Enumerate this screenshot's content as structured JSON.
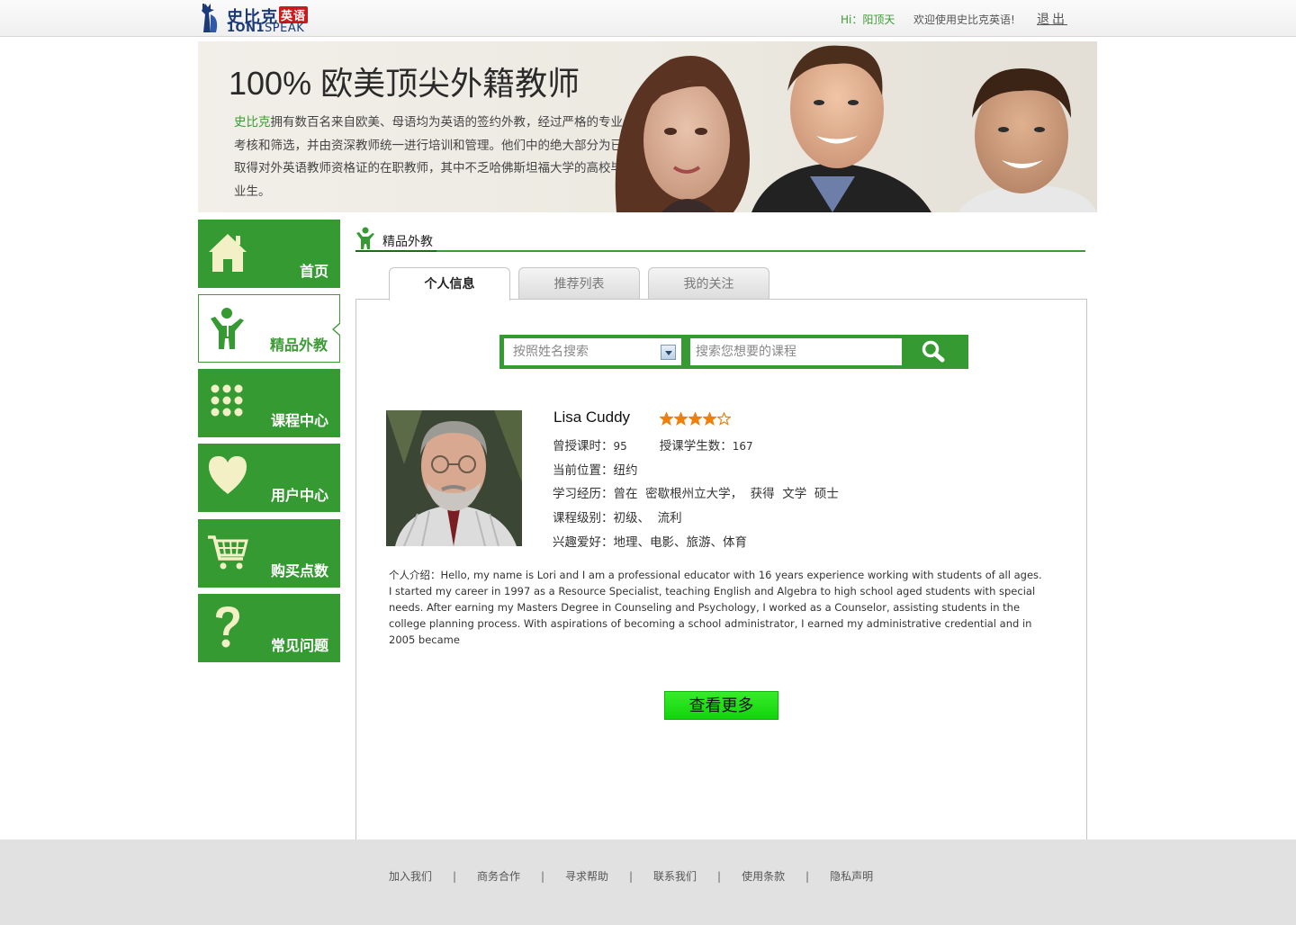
{
  "header": {
    "logo": {
      "cn": "史比克",
      "cn_badge": "英语",
      "en_bold": "1ON1",
      "en_light": "SPEAK"
    },
    "greeting": "Hi：阳顶天",
    "welcome": "欢迎使用史比克英语!",
    "logout": "退出"
  },
  "banner": {
    "title": "100% 欧美顶尖外籍教师",
    "brand": "史比克",
    "text": "拥有数百名来自欧美、母语均为英语的签约外教，经过严格的专业考核和筛选，并由资深教师统一进行培训和管理。他们中的绝大部分为已取得对外英语教师资格证的在职教师，其中不乏哈佛斯坦福大学的高校毕业生。"
  },
  "sidebar": {
    "items": [
      {
        "label": "首页",
        "icon": "home-icon",
        "active": false
      },
      {
        "label": "精品外教",
        "icon": "teacher-icon",
        "active": true
      },
      {
        "label": "课程中心",
        "icon": "grid-dots-icon",
        "active": false
      },
      {
        "label": "用户中心",
        "icon": "heart-icon",
        "active": false
      },
      {
        "label": "购买点数",
        "icon": "cart-icon",
        "active": false
      },
      {
        "label": "常见问题",
        "icon": "question-icon",
        "active": false
      }
    ]
  },
  "section": {
    "title": "精品外教"
  },
  "tabs": [
    {
      "label": "个人信息",
      "active": true
    },
    {
      "label": "推荐列表",
      "active": false
    },
    {
      "label": "我的关注",
      "active": false
    }
  ],
  "search": {
    "select_placeholder": "按照姓名搜索",
    "input_placeholder": "搜索您想要的课程"
  },
  "teacher": {
    "name": "Lisa Cuddy",
    "rating": 4,
    "rating_max": 5,
    "hours_label": "曾授课时：",
    "hours": "95",
    "students_label": "授课学生数：",
    "students": "167",
    "location_label": "当前位置：",
    "location": "纽约",
    "education_label": "学习经历：",
    "education": "曾在  密歇根州立大学，  获得  文学  硕士",
    "level_label": "课程级别：",
    "level": "初级、  流利",
    "hobby_label": "兴趣爱好：",
    "hobby": "地理、电影、旅游、体育",
    "bio_label": "个人介绍：",
    "bio": "Hello, my name is Lori and I am a professional educator with 16 years experience working with students of all ages. I started my career in 1997 as a Resource Specialist, teaching English and Algebra to high school aged students with special needs. After earning my Masters Degree in Counseling and Psychology, I worked as a Counselor, assisting students in the college planning process. With aspirations of becoming a school administrator, I earned my administrative credential and in 2005 became"
  },
  "more_button": "查看更多",
  "footer": {
    "links": [
      "加入我们",
      "商务合作",
      "寻求帮助",
      "联系我们",
      "使用条款",
      "隐私声明"
    ],
    "separator": "|"
  },
  "colors": {
    "brand_green": "#349a31",
    "accent_green": "#3d9b35",
    "button_green": "#12d40c",
    "star_orange": "#f07f0a",
    "logo_blue": "#1d3a78",
    "logo_red": "#c91b1b",
    "footer_bg": "#e1e1e1"
  }
}
